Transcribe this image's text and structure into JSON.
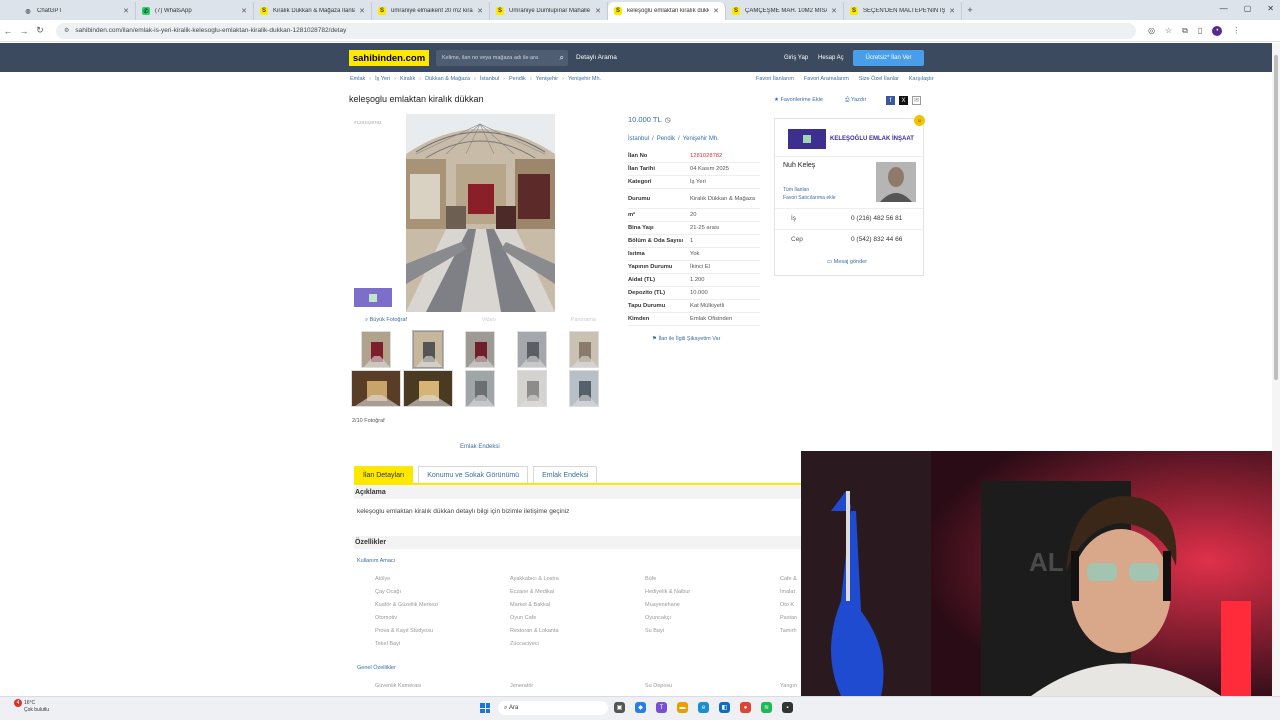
{
  "browser": {
    "tabs": [
      {
        "title": "ChatGPT",
        "icon": "chatgpt-icon",
        "color": "#333333"
      },
      {
        "title": "(7) WhatsApp",
        "icon": "whatsapp-icon",
        "color": "#25d366"
      },
      {
        "title": "Kiralık Dükkan & Mağaza İlanla",
        "icon": "sahibinden-icon",
        "color": "#ffe800"
      },
      {
        "title": "ümraniye elmaikent 20 m2 kira",
        "icon": "sahibinden-icon",
        "color": "#ffe800"
      },
      {
        "title": "Ümraniye Dumlupınar Mahalle",
        "icon": "sahibinden-icon",
        "color": "#ffe800"
      },
      {
        "title": "keleşoglu emlaktan kiralık dükk",
        "icon": "sahibinden-icon",
        "color": "#ffe800",
        "active": true
      },
      {
        "title": "ÇAMÇEŞME MAH. 10M2 MİSAF",
        "icon": "sahibinden-icon",
        "color": "#ffe800"
      },
      {
        "title": "SEÇEN'DEN MALTEPE'NİN İŞLE",
        "icon": "sahibinden-icon",
        "color": "#ffe800"
      }
    ],
    "new_tab": "+",
    "url": "sahibinden.com/ilan/emlak-is-yeri-kiralik-kelesoglu-emlaktan-kiralik-dukkan-1281028782/detay"
  },
  "header": {
    "logo": "sahibinden.com",
    "search_placeholder": "Kelime, ilan no veya mağaza adı ile ara",
    "detayli_arama": "Detaylı Arama",
    "giris": "Giriş Yap",
    "hesap_ac": "Hesap Aç",
    "ilan_ver": "Ücretsiz* İlan Ver"
  },
  "breadcrumb": [
    "Emlak",
    "İş Yeri",
    "Kiralık",
    "Dükkan & Mağaza",
    "İstanbul",
    "Pendik",
    "Yenişehir",
    "Yenişehir Mh."
  ],
  "top_links": [
    "Favori İlanlarım",
    "Favori Aramalarım",
    "Size Özel İlanlar",
    "Karşılaştır"
  ],
  "listing": {
    "title": "keleşoglu emlaktan kiralık dükkan",
    "fav_ekle": "Favorilerime Ekle",
    "yazdir": "Yazdır",
    "id_small": "#1281028782",
    "buyuk_foto": "Büyük Fotoğraf",
    "video": "Video",
    "panorama": "Panorama",
    "foto_count": "2/10 Fotoğraf",
    "emlak_endeksi": "Emlak Endeksi",
    "price": "10.000 TL",
    "location": [
      "İstanbul",
      "Pendik",
      "Yenişehir Mh."
    ],
    "props": [
      {
        "k": "İlan No",
        "v": "1281028782",
        "red": true
      },
      {
        "k": "İlan Tarihi",
        "v": "04 Kasım 2025"
      },
      {
        "k": "Kategori",
        "v": "İş Yeri"
      },
      {
        "k": "Durumu",
        "v": "Kiralık Dükkan & Mağaza",
        "tall": true
      },
      {
        "k": "m²",
        "v": "20"
      },
      {
        "k": "Bina Yaşı",
        "v": "21-25 arası"
      },
      {
        "k": "Bölüm & Oda Sayısı",
        "v": "1"
      },
      {
        "k": "Isıtma",
        "v": "Yok"
      },
      {
        "k": "Yapının Durumu",
        "v": "İkinci El"
      },
      {
        "k": "Aidat (TL)",
        "v": "1.200"
      },
      {
        "k": "Depozito (TL)",
        "v": "10.000"
      },
      {
        "k": "Tapu Durumu",
        "v": "Kat Mülkiyetli"
      },
      {
        "k": "Kimden",
        "v": "Emlak Ofisinden"
      }
    ],
    "sikayet": "İlan ile İlgili Şikayetim Var"
  },
  "seller": {
    "company": "KELEŞOĞLU EMLAK İNŞAAT",
    "person": "Nuh Keleş",
    "tum_ilanlari": "Tüm İlanları",
    "favori_satici": "Favori Satıcılarıma ekle",
    "phones": [
      {
        "label": "İş",
        "number": "0 (216) 482 56 81"
      },
      {
        "label": "Cep",
        "number": "0 (542) 832 44 66"
      }
    ],
    "mesaj": "Mesaj gönder"
  },
  "detail_tabs": [
    "İlan Detayları",
    "Konumu ve Sokak Görünümü",
    "Emlak Endeksi"
  ],
  "aciklama": {
    "heading": "Açıklama",
    "text": "keleşoglu emlaktan kiralık dükkan detaylı bilgi için bizimle iletişime geçiniz"
  },
  "ozellikler": {
    "heading": "Özellikler",
    "kullanim_amaci": "Kullanım Amacı",
    "features": [
      "Atölye",
      "Ayakkabıcı & Lostra",
      "Büfe",
      "Cafe &",
      "Çay Ocağı",
      "Eczane & Medikal",
      "Hediyelik & Nalbur",
      "İmalat",
      "Kuaför & Güzellik Merkezi",
      "Market & Bakkal",
      "Muayenehane",
      "Oto K",
      "Otomotiv",
      "Oyun Cafe",
      "Oyuncakçı",
      "Pastan",
      "Prova & Kayıt Stüdyosu",
      "Restoran & Lokanta",
      "Su Bayi",
      "Tamirh",
      "Tekel Bayi",
      "Züccaciyeci"
    ],
    "genel_ozellikler": "Genel Özellikler",
    "genel": [
      "Güvenlik Kamerası",
      "Jeneratör",
      "Su Deposu",
      "Yangın"
    ]
  },
  "taskbar": {
    "temp": "16°C",
    "weather": "Çok bulutlu",
    "badge": "4",
    "search": "Ara"
  }
}
